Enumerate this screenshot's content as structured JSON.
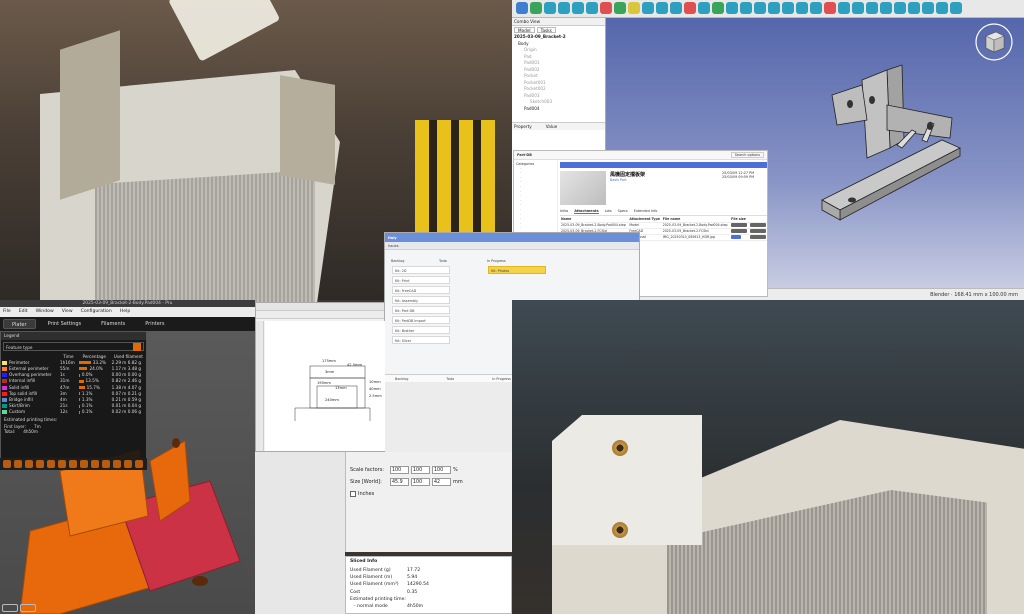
{
  "freecad": {
    "combo_title": "Combo View",
    "tabs": [
      "Model",
      "Tasks"
    ],
    "tree": [
      "2025-03-09_Bracket-2",
      "Body",
      "Origin",
      "Pad",
      "Pad001",
      "Pad002",
      "Pocket",
      "Pocket001",
      "Pocket002",
      "Pad003",
      "Sketch003",
      "Pad004"
    ],
    "prop_headers": [
      "Property",
      "Value"
    ],
    "status": "Blender  ·  168.41 mm x 100.00 mm"
  },
  "partdb": {
    "nav_title": "Part-DB",
    "search_placeholder": "Search options",
    "side_items": [
      "Categories",
      "Projects",
      "Tools",
      "Storage"
    ],
    "part_title": "風機固定擋板架",
    "meta": [
      "Basis Part",
      "25/03/09 12:27 PM",
      "25/03/09 09:59 PM"
    ],
    "section_tabs": [
      "Infos",
      "Attachments",
      "Lots",
      "Specs",
      "Extended Info"
    ],
    "columns": [
      "Name",
      "Attachment Type",
      "File name",
      "File size"
    ],
    "rows": [
      [
        "2025-03-09_Bracket-2-Body.Pad004.step",
        "Model",
        "2025-03-09_Bracket-2-Body.Pad004.step",
        ""
      ],
      [
        "2025-03-09_Bracket-2.FCStd",
        "FreeCAD",
        "2025-03-09_Bracket-2.FCStd",
        ""
      ],
      [
        "IMG_20250310_085613_HDR.jpg",
        "Thumbnail",
        "IMG_20250310_085613_HDR.jpg",
        ""
      ]
    ]
  },
  "kanban": {
    "brand": "Huly",
    "filter_label": "Issues",
    "columns": [
      "Backlog",
      "Todo",
      "In Progress"
    ],
    "cards": [
      "Kit: 2D",
      "Kit: Print",
      "Kit: FreeCAD",
      "Kit: Assembly",
      "Kit: Part DB",
      "Kit: PartDB Import",
      "Kit: Brother",
      "Kit: Slicer",
      "Kit: Photos"
    ],
    "footer": [
      "Backlog",
      "Todo",
      "In Progress",
      "Done"
    ]
  },
  "orca": {
    "window_title": "2025-03-09_Bracket-2-Body.Pad004 - Pru",
    "menu": [
      "File",
      "Edit",
      "Window",
      "View",
      "Configuration",
      "Help"
    ],
    "tabs": [
      "Plater",
      "Print Settings",
      "Filaments",
      "Printers"
    ],
    "legend_title": "Legend",
    "feature_type_label": "Feature type",
    "legend_headers": [
      "",
      "Time",
      "Percentage",
      "Used filament"
    ],
    "legend_rows": [
      {
        "name": "Perimeter",
        "color": "#ffe066",
        "time": "1h16m",
        "pct": "33.2%",
        "used": "2.29 m   6.82 g",
        "bar": 0.33
      },
      {
        "name": "External perimeter",
        "color": "#ff7d38",
        "time": "55m",
        "pct": "24.0%",
        "used": "1.17 m   3.48 g",
        "bar": 0.24
      },
      {
        "name": "Overhang perimeter",
        "color": "#1f1fff",
        "time": "1s",
        "pct": "0.0%",
        "used": "0.00 m   0.00 g",
        "bar": 0.0
      },
      {
        "name": "Internal infill",
        "color": "#b03029",
        "time": "31m",
        "pct": "13.5%",
        "used": "0.82 m   2.46 g",
        "bar": 0.13
      },
      {
        "name": "Solid infill",
        "color": "#d732d7",
        "time": "47m",
        "pct": "15.7%",
        "used": "1.38 m   4.07 g",
        "bar": 0.16
      },
      {
        "name": "Top solid infill",
        "color": "#ff1a1a",
        "time": "3m",
        "pct": "1.1%",
        "used": "0.07 m   0.21 g",
        "bar": 0.01
      },
      {
        "name": "Bridge infill",
        "color": "#5c8cce",
        "time": "4m",
        "pct": "1.3%",
        "used": "0.21 m   0.59 g",
        "bar": 0.01
      },
      {
        "name": "Skirt/Brim",
        "color": "#009b82",
        "time": "21s",
        "pct": "0.1%",
        "used": "0.01 m   0.04 g",
        "bar": 0.0
      },
      {
        "name": "Custom",
        "color": "#5ed69c",
        "time": "12s",
        "pct": "0.1%",
        "used": "0.02 m   0.06 g",
        "bar": 0.0
      }
    ],
    "est_label": "Estimated printing times:",
    "est_rows": [
      [
        "First layer:",
        "7m"
      ],
      [
        "Total:",
        "4h50m"
      ]
    ],
    "slider_top": "0.20",
    "slider_bottom": "1"
  },
  "inkscape": {
    "dims": [
      "175mm",
      "42.5mm",
      "3mm",
      "190mm",
      "10mm",
      "40mm",
      "240mm",
      "13mm",
      "2.5mm"
    ]
  },
  "scale": {
    "scale_label": "Scale factors:",
    "scale_vals": [
      "100",
      "100",
      "100"
    ],
    "scale_unit": "%",
    "size_label": "Size [World]:",
    "size_vals": [
      "45.9",
      "100",
      "42"
    ],
    "size_unit": "mm",
    "inches_label": "Inches"
  },
  "sliced": {
    "title": "Sliced Info",
    "rows": [
      [
        "Used Filament (g)",
        "17.72"
      ],
      [
        "Used Filament (m)",
        "5.94"
      ],
      [
        "Used Filament (mm³)",
        "14290.54"
      ],
      [
        "Cost",
        "0.35"
      ],
      [
        "Estimated printing time:",
        ""
      ],
      [
        "- normal mode",
        "4h50m"
      ]
    ]
  }
}
